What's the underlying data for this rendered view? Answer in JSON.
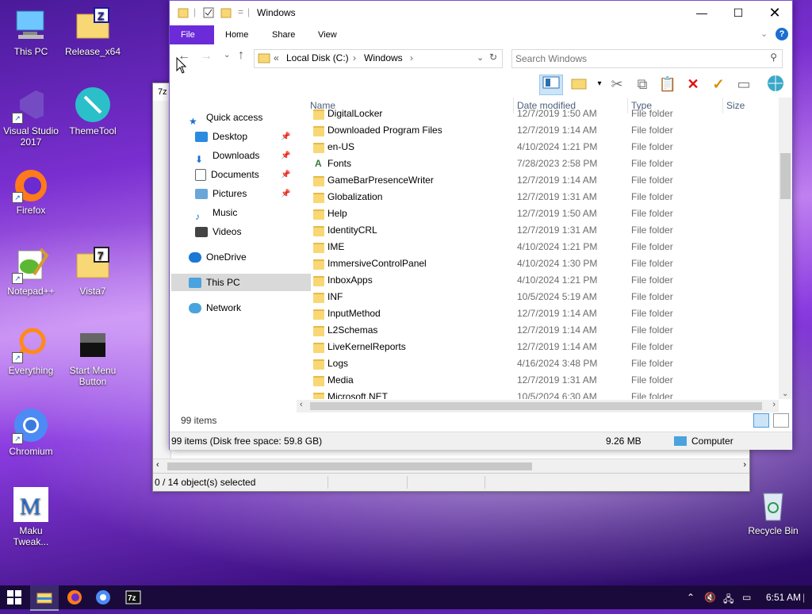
{
  "desktop": {
    "icons": [
      {
        "label": "This PC",
        "icon": "this-pc-icon"
      },
      {
        "label": "Release_x64",
        "icon": "zip-folder-icon"
      },
      {
        "label": "Visual Studio 2017",
        "icon": "visual-studio-icon"
      },
      {
        "label": "ThemeTool",
        "icon": "themetool-icon"
      },
      {
        "label": "Firefox",
        "icon": "firefox-icon"
      },
      {
        "label": "Notepad++",
        "icon": "notepadpp-icon"
      },
      {
        "label": "Vista7",
        "icon": "zip-folder-icon"
      },
      {
        "label": "Everything",
        "icon": "everything-icon"
      },
      {
        "label": "Start Menu Button",
        "icon": "start-menu-button-icon"
      },
      {
        "label": "Chromium",
        "icon": "chromium-icon"
      },
      {
        "label": "Maku Tweak...",
        "icon": "maku-tweak-icon"
      },
      {
        "label": "Recycle Bin",
        "icon": "recycle-bin-icon"
      }
    ]
  },
  "zipwin": {
    "title": "7z",
    "status": "0 / 14 object(s) selected"
  },
  "explorer": {
    "title": "Windows",
    "ribbon_tabs": [
      "File",
      "Home",
      "Share",
      "View"
    ],
    "breadcrumb": [
      "«",
      "Local Disk (C:)",
      "Windows"
    ],
    "search_placeholder": "Search Windows",
    "nav": [
      {
        "label": "Quick access",
        "icon": "star-icon",
        "pinned": false
      },
      {
        "label": "Desktop",
        "icon": "desktop-icon",
        "pinned": true
      },
      {
        "label": "Downloads",
        "icon": "download-icon",
        "pinned": true
      },
      {
        "label": "Documents",
        "icon": "documents-icon",
        "pinned": true
      },
      {
        "label": "Pictures",
        "icon": "pictures-icon",
        "pinned": true
      },
      {
        "label": "Music",
        "icon": "music-icon",
        "pinned": false
      },
      {
        "label": "Videos",
        "icon": "videos-icon",
        "pinned": false
      },
      {
        "label": "OneDrive",
        "icon": "cloud-icon",
        "pinned": false
      },
      {
        "label": "This PC",
        "icon": "computer-icon",
        "pinned": false
      },
      {
        "label": "Network",
        "icon": "network-icon",
        "pinned": false
      }
    ],
    "columns": [
      "Name",
      "Date modified",
      "Type",
      "Size"
    ],
    "files": [
      {
        "name": "DigitalLocker",
        "date": "12/7/2019 1:50 AM",
        "type": "File folder"
      },
      {
        "name": "Downloaded Program Files",
        "date": "12/7/2019 1:14 AM",
        "type": "File folder"
      },
      {
        "name": "en-US",
        "date": "4/10/2024 1:21 PM",
        "type": "File folder"
      },
      {
        "name": "Fonts",
        "date": "7/28/2023 2:58 PM",
        "type": "File folder"
      },
      {
        "name": "GameBarPresenceWriter",
        "date": "12/7/2019 1:14 AM",
        "type": "File folder"
      },
      {
        "name": "Globalization",
        "date": "12/7/2019 1:31 AM",
        "type": "File folder"
      },
      {
        "name": "Help",
        "date": "12/7/2019 1:50 AM",
        "type": "File folder"
      },
      {
        "name": "IdentityCRL",
        "date": "12/7/2019 1:31 AM",
        "type": "File folder"
      },
      {
        "name": "IME",
        "date": "4/10/2024 1:21 PM",
        "type": "File folder"
      },
      {
        "name": "ImmersiveControlPanel",
        "date": "4/10/2024 1:30 PM",
        "type": "File folder"
      },
      {
        "name": "InboxApps",
        "date": "4/10/2024 1:21 PM",
        "type": "File folder"
      },
      {
        "name": "INF",
        "date": "10/5/2024 5:19 AM",
        "type": "File folder"
      },
      {
        "name": "InputMethod",
        "date": "12/7/2019 1:14 AM",
        "type": "File folder"
      },
      {
        "name": "L2Schemas",
        "date": "12/7/2019 1:14 AM",
        "type": "File folder"
      },
      {
        "name": "LiveKernelReports",
        "date": "12/7/2019 1:14 AM",
        "type": "File folder"
      },
      {
        "name": "Logs",
        "date": "4/16/2024 3:48 PM",
        "type": "File folder"
      },
      {
        "name": "Media",
        "date": "12/7/2019 1:31 AM",
        "type": "File folder"
      },
      {
        "name": "Microsoft.NET",
        "date": "10/5/2024 6:30 AM",
        "type": "File folder"
      }
    ],
    "item_count": "99 items",
    "status_left": "99 items (Disk free space: 59.8 GB)",
    "status_size": "9.26 MB",
    "status_location": "Computer"
  },
  "taskbar": {
    "clock": "6:51 AM",
    "apps": [
      "start-icon",
      "file-explorer-icon",
      "firefox-icon",
      "chromium-icon",
      "7zip-icon"
    ]
  }
}
